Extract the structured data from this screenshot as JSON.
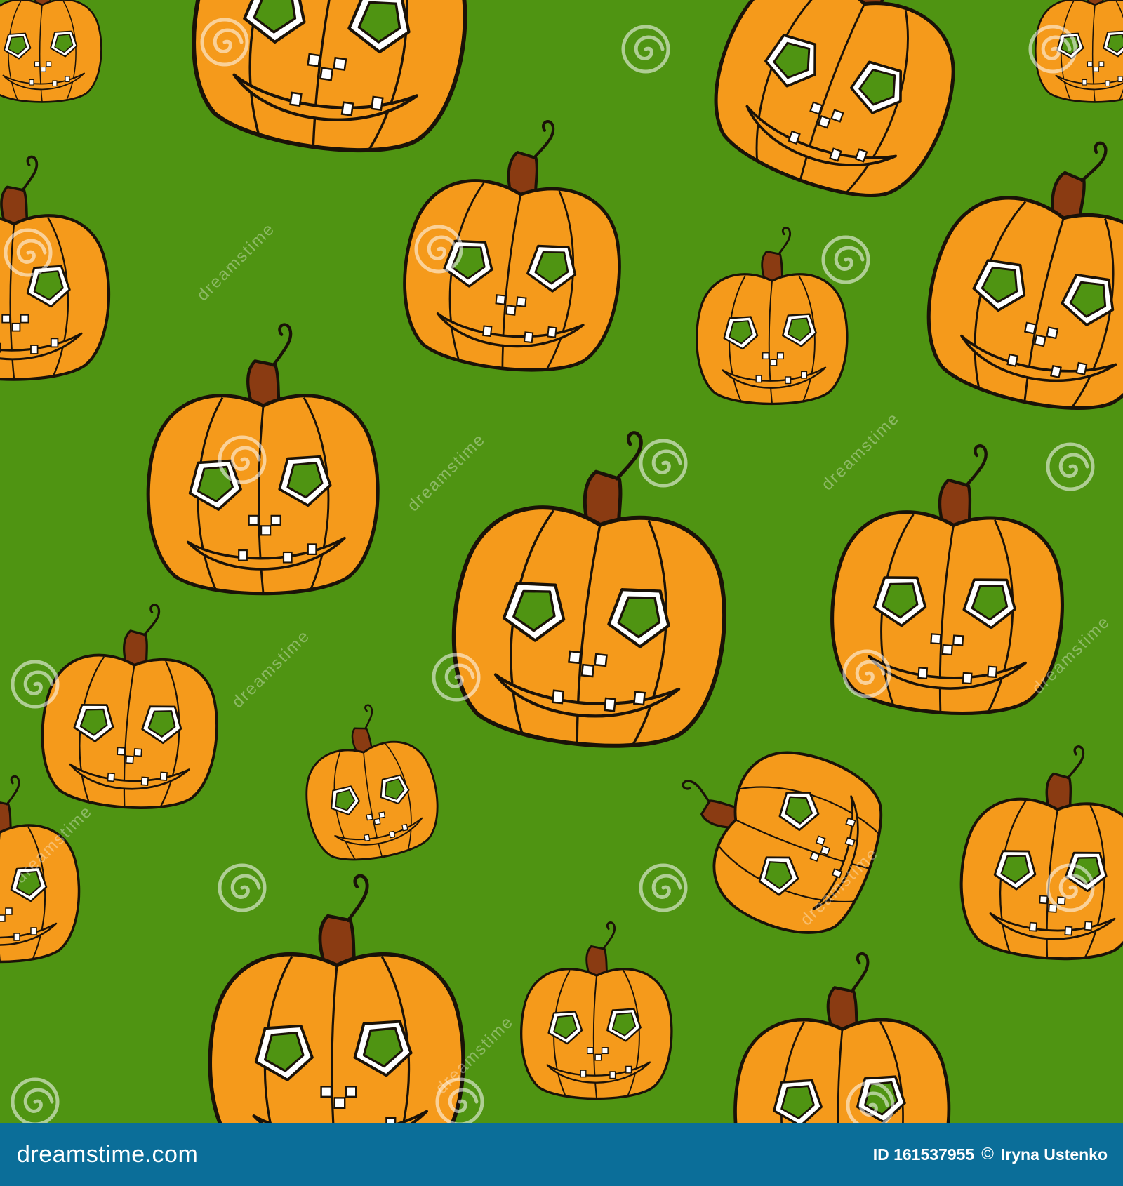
{
  "image": {
    "background_color": "#4f9412",
    "pumpkin_fill": "#f59a1b",
    "pumpkin_outline": "#1a1208",
    "stem_color": "#8a3b12",
    "eye_fill": "#4f9412",
    "tooth_fill": "#ffffff",
    "watermark_text": "dreamstime",
    "subject": "pumpkin-icon"
  },
  "footer": {
    "background_color": "#0b6e99",
    "brand_name": "dreamstime",
    "brand_tld": ".com",
    "image_id": "ID 161537955",
    "copyright_symbol": "©",
    "author": "Iryna Ustenko",
    "logo_icon": "spiral-logo-icon"
  }
}
